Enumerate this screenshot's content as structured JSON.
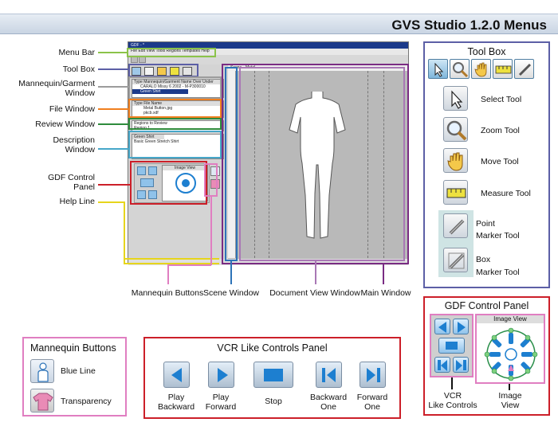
{
  "header": {
    "title": "GVS Studio 1.2.0 Menus",
    "bar_color": "#cfdbe8"
  },
  "colors": {
    "menu_bar": "#8bc34a",
    "tool_box": "#5c5fa6",
    "mannequin_window": "#9c9c9c",
    "file_window": "#f07f1f",
    "review_window": "#2e8b3c",
    "description_window": "#46a7c9",
    "gdf_control": "#cc1f29",
    "help_line": "#e6d51c",
    "mannequin_buttons": "#e07ec1",
    "scene_window": "#2d73b8",
    "document_view": "#a978b5",
    "main_window": "#7a2c83"
  },
  "left_labels": {
    "menu_bar": "Menu Bar",
    "tool_box": "Tool Box",
    "mannequin_line1": "Mannequin/Garment",
    "mannequin_line2": "Window",
    "file_window": "File Window",
    "review_window": "Review Window",
    "description_line1": "Description",
    "description_line2": "Window",
    "gdf_line1": "GDF Control",
    "gdf_line2": "Panel",
    "help_line": "Help Line"
  },
  "bottom_labels": {
    "mannequin_buttons": "Mannequin Buttons",
    "scene_window": "Scene Window",
    "document_view": "Document View Window",
    "main_window": "Main Window"
  },
  "screenshot": {
    "app_title": "GDF - *",
    "menu": "File   Edit   View   Tools   Regions   Templates   Help",
    "mannequin_header": "Type  Mannequin/Garment Name   Over Under",
    "mannequin_row1": "CARALO Missy 6 2002 - M-P300010",
    "mannequin_row2": "Green Shirt",
    "file_header": "Type   File Name",
    "file_row1": "Metal Button.jpg",
    "file_row2": "pkcb.xdf",
    "review_row1": "Regions to Review",
    "review_row2": "Region 1",
    "description_title": "Green Shirt",
    "description_text": "Basic Green Stretch Shirt",
    "image_view_label": "Image View",
    "tab_scene": "Scene",
    "tab_metal": "Metal"
  },
  "tool_box": {
    "title": "Tool Box",
    "tools": [
      {
        "label": "Select Tool",
        "icon": "arrow-cursor-icon"
      },
      {
        "label": "Zoom Tool",
        "icon": "magnifier-icon"
      },
      {
        "label": "Move Tool",
        "icon": "hand-icon"
      },
      {
        "label": "Measure Tool",
        "icon": "ruler-icon"
      },
      {
        "label_line1": "Point",
        "label_line2": "Marker Tool",
        "icon": "point-marker-icon"
      },
      {
        "label_line1": "Box",
        "label_line2": "Marker Tool",
        "icon": "box-marker-icon"
      }
    ]
  },
  "gdf_panel": {
    "title": "GDF Control Panel",
    "image_view_label": "Image View",
    "vcr_line1": "VCR",
    "vcr_line2": "Like Controls",
    "image_line1": "Image",
    "image_line2": "View"
  },
  "mannequin_buttons_panel": {
    "title": "Mannequin Buttons",
    "items": [
      {
        "label": "Blue Line",
        "icon": "blue-line-figure-icon"
      },
      {
        "label": "Transparency",
        "icon": "transparency-shirt-icon"
      }
    ]
  },
  "vcr_panel": {
    "title": "VCR Like Controls Panel",
    "buttons": [
      {
        "line1": "Play",
        "line2": "Backward",
        "icon": "play-backward-icon"
      },
      {
        "line1": "Play",
        "line2": "Forward",
        "icon": "play-forward-icon"
      },
      {
        "line1": "Stop",
        "line2": "",
        "icon": "stop-icon"
      },
      {
        "line1": "Backward",
        "line2": "One",
        "icon": "backward-one-icon"
      },
      {
        "line1": "Forward",
        "line2": "One",
        "icon": "forward-one-icon"
      }
    ]
  }
}
